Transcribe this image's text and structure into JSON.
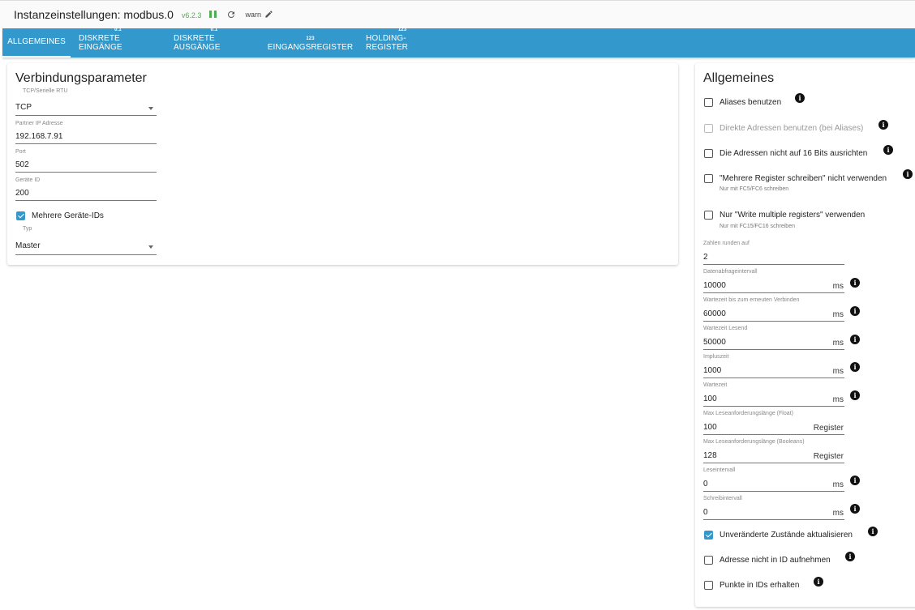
{
  "header": {
    "title": "Instanzeinstellungen: modbus.0",
    "version": "v6.2.3",
    "log_level": "warn",
    "colors": {
      "version": "#4caf50",
      "pause": "#4caf50"
    },
    "icons": [
      "pause-icon",
      "reload-icon",
      "edit-icon"
    ]
  },
  "tabs": [
    {
      "label": "ALLGEMEINES",
      "icon_text": ""
    },
    {
      "label": "DISKRETE EINGÄNGE",
      "icon_text": "0.1"
    },
    {
      "label": "DISKRETE AUSGÄNGE",
      "icon_text": "0.1"
    },
    {
      "label": "EINGANGSREGISTER",
      "icon_text": "123"
    },
    {
      "label": "HOLDING-REGISTER",
      "icon_text": "123"
    }
  ],
  "tabs_color": "#3399cc",
  "accent_color": "#3399cc",
  "connection": {
    "heading": "Verbindungsparameter",
    "type": {
      "label": "TCP/Serielle RTU",
      "value": "TCP"
    },
    "ip": {
      "label": "Partner IP Adresse",
      "value": "192.168.7.91"
    },
    "port": {
      "label": "Port",
      "value": "502"
    },
    "device_id": {
      "label": "Geräte ID",
      "value": "200"
    },
    "multi_ids": {
      "label": "Mehrere Geräte-IDs",
      "checked": true
    },
    "mode": {
      "label": "Typ",
      "value": "Master"
    }
  },
  "general": {
    "heading": "Allgemeines",
    "checkboxes": [
      {
        "label": "Aliases benutzen",
        "checked": false,
        "disabled": false,
        "help": ""
      },
      {
        "label": "Direkte Adressen benutzen (bei Aliases)",
        "checked": false,
        "disabled": true,
        "help": ""
      },
      {
        "label": "Die Adressen nicht auf 16 Bits ausrichten",
        "checked": false,
        "disabled": false,
        "help": ""
      },
      {
        "label": "\"Mehrere Register schreiben\" nicht verwenden",
        "checked": false,
        "disabled": false,
        "help": "Nur mit FC5/FC6 schreiben"
      },
      {
        "label": "Nur \"Write multiple registers\" verwenden",
        "checked": false,
        "disabled": false,
        "help": "Nur mit FC15/FC16 schreiben"
      }
    ],
    "fields": [
      {
        "label": "Zahlen runden auf",
        "value": "2",
        "unit": ""
      },
      {
        "label": "Datenabfrageintervall",
        "value": "10000",
        "unit": "ms"
      },
      {
        "label": "Wartezeit bis zum erneuten Verbinden",
        "value": "60000",
        "unit": "ms"
      },
      {
        "label": "Wartezeit Lesend",
        "value": "50000",
        "unit": "ms"
      },
      {
        "label": "Impluszeit",
        "value": "1000",
        "unit": "ms"
      },
      {
        "label": "Wartezeit",
        "value": "100",
        "unit": "ms"
      },
      {
        "label": "Max Leseanforderungslänge (Float)",
        "value": "100",
        "unit": "Register"
      },
      {
        "label": "Max Leseanforderungslänge (Booleans)",
        "value": "128",
        "unit": "Register"
      },
      {
        "label": "Leseintervall",
        "value": "0",
        "unit": "ms"
      },
      {
        "label": "Schreibintervall",
        "value": "0",
        "unit": "ms"
      }
    ],
    "bottom_checkboxes": [
      {
        "label": "Unveränderte Zustände aktualisieren",
        "checked": true
      },
      {
        "label": "Adresse nicht in ID aufnehmen",
        "checked": false
      },
      {
        "label": "Punkte in IDs erhalten",
        "checked": false
      }
    ]
  }
}
